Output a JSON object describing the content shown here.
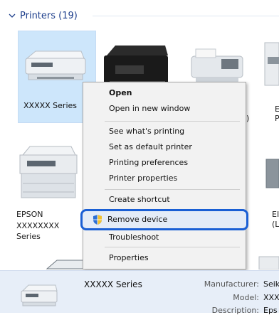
{
  "group": {
    "title": "Printers (19)"
  },
  "tiles": {
    "t1_caption": "XXXXX Series",
    "t3_caption_fragment": ")",
    "t4_caption_fragment_a": "E",
    "t4_caption_fragment_b": "P",
    "t5_caption_line1": "EPSON",
    "t5_caption_line2": "XXXXXXXX",
    "t5_caption_line3": "Series",
    "t8_caption_fragment_a": "EI",
    "t8_caption_fragment_b": "(L"
  },
  "context_menu": {
    "items": [
      {
        "label": "Open",
        "bold": true
      },
      {
        "label": "Open in new window"
      },
      {
        "label": "See what's printing"
      },
      {
        "label": "Set as default printer"
      },
      {
        "label": "Printing preferences"
      },
      {
        "label": "Printer properties"
      },
      {
        "label": "Create shortcut"
      },
      {
        "label": "Remove device",
        "highlighted": true,
        "icon": "shield-icon"
      },
      {
        "label": "Troubleshoot"
      },
      {
        "label": "Properties"
      }
    ]
  },
  "details": {
    "name": "XXXXX Series",
    "manufacturer_label": "Manufacturer:",
    "manufacturer_value": "Seik",
    "model_label": "Model:",
    "model_value": "XXX",
    "description_label": "Description:",
    "description_value": "Eps"
  },
  "colors": {
    "selection_bg": "#cde6fb",
    "highlight_border": "#1a5fd4",
    "menu_bg": "#f2f2f2",
    "header_text": "#1e3f8c",
    "details_bg": "#e7eef8"
  }
}
